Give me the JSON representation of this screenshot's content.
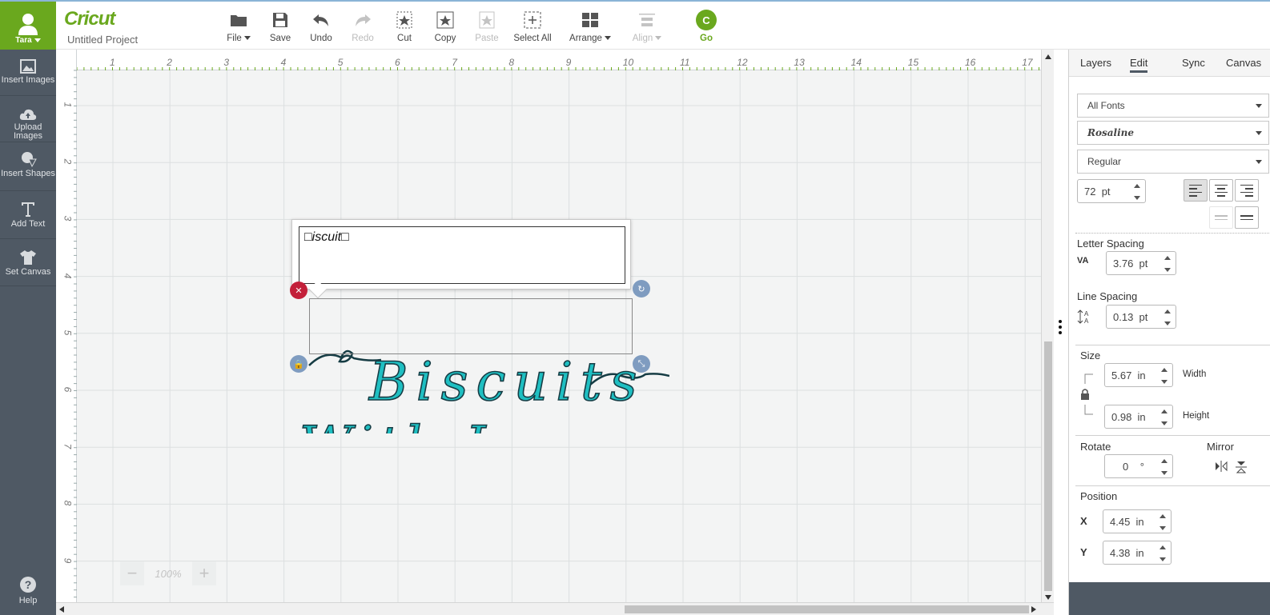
{
  "user": {
    "name": "Tara"
  },
  "app": {
    "logo": "Cricut",
    "project_title": "Untitled Project"
  },
  "toolbar": {
    "file": "File",
    "save": "Save",
    "undo": "Undo",
    "redo": "Redo",
    "cut": "Cut",
    "copy": "Copy",
    "paste": "Paste",
    "select_all": "Select All",
    "arrange": "Arrange",
    "align": "Align",
    "go": "Go",
    "go_glyph": "C"
  },
  "sidebar": {
    "items": [
      {
        "label": "Insert Images",
        "icon": "image-icon"
      },
      {
        "label": "Upload Images",
        "icon": "cloud-upload-icon"
      },
      {
        "label": "Insert Shapes",
        "icon": "shapes-icon"
      },
      {
        "label": "Add Text",
        "icon": "text-icon"
      },
      {
        "label": "Set Canvas",
        "icon": "shirt-icon"
      }
    ],
    "help": "Help"
  },
  "canvas": {
    "ruler_h": [
      "1",
      "2",
      "3",
      "4",
      "5",
      "6",
      "7",
      "8",
      "9",
      "10",
      "11",
      "12",
      "13",
      "14",
      "15",
      "16",
      "17"
    ],
    "ruler_v": [
      "1",
      "2",
      "3",
      "4",
      "5",
      "6",
      "7",
      "8",
      "9"
    ],
    "zoom_value": "100%",
    "zoom_minus": "−",
    "zoom_plus": "+",
    "text_edit_value": "□iscuit□",
    "art_line1": "Biscuits",
    "art_line2": "With Love",
    "art_color": "#1fbfc2"
  },
  "panel": {
    "tabs": [
      "Layers",
      "Edit",
      "Sync",
      "Canvas"
    ],
    "active_tab": "Edit",
    "font_filter": "All Fonts",
    "font_name": "Rosaline",
    "font_style": "Regular",
    "font_size": "72",
    "font_size_unit": "pt",
    "letter_spacing_label": "Letter Spacing",
    "letter_spacing_icon_text": "VA",
    "letter_spacing": "3.76",
    "letter_spacing_unit": "pt",
    "line_spacing_label": "Line Spacing",
    "line_spacing": "0.13",
    "line_spacing_unit": "pt",
    "size_label": "Size",
    "width": "5.67",
    "width_unit": "in",
    "width_label": "Width",
    "height": "0.98",
    "height_unit": "in",
    "height_label": "Height",
    "rotate_label": "Rotate",
    "rotate": "0",
    "rotate_unit": "°",
    "mirror_label": "Mirror",
    "position_label": "Position",
    "x_label": "X",
    "x": "4.45",
    "x_unit": "in",
    "y_label": "Y",
    "y": "4.38",
    "y_unit": "in"
  },
  "colors": {
    "brand": "#6aa81e",
    "sidebar": "#4f5964",
    "handle": "#7f9cc0",
    "delete": "#c3203a"
  }
}
